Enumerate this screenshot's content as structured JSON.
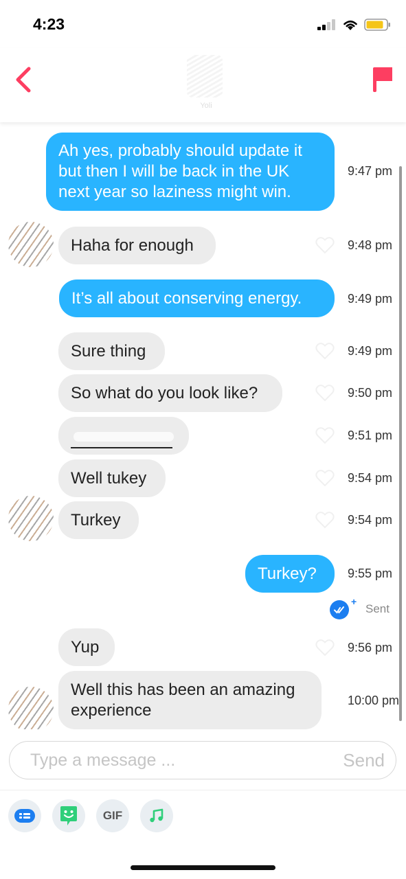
{
  "status_bar": {
    "time": "4:23"
  },
  "header": {
    "contact_name": "Yoli"
  },
  "messages": [
    {
      "side": "sent",
      "text": "Ah yes, probably should update it\nbut then I will be back in the UK\nnext year so laziness might win.",
      "time": "9:47 pm"
    },
    {
      "side": "received",
      "text": "Haha for enough",
      "time": "9:48 pm"
    },
    {
      "side": "sent",
      "text": "It’s all about conserving energy.",
      "time": "9:49 pm"
    },
    {
      "side": "received",
      "text": "Sure thing",
      "time": "9:49 pm"
    },
    {
      "side": "received",
      "text": "So what do you look like?",
      "time": "9:50 pm"
    },
    {
      "side": "received",
      "text": "",
      "time": "9:51 pm",
      "redacted": true
    },
    {
      "side": "received",
      "text": "Well tukey",
      "time": "9:54 pm"
    },
    {
      "side": "received",
      "text": "Turkey",
      "time": "9:54 pm"
    },
    {
      "side": "sent",
      "text": "Turkey?",
      "time": "9:55 pm"
    },
    {
      "side": "received",
      "text": "Yup",
      "time": "9:56 pm"
    },
    {
      "side": "received",
      "text": "Well this has been an amazing\nexperience",
      "time": "10:00 pm"
    }
  ],
  "read_receipt": {
    "label": "Sent"
  },
  "composer": {
    "placeholder": "Type a message ...",
    "send_label": "Send"
  },
  "toolbar": {
    "gif_label": "GIF"
  },
  "colors": {
    "accent": "#fd3e61",
    "sent_bubble": "#29b4ff",
    "received_bubble": "#ececec",
    "read_receipt": "#1c7ef0",
    "sticker": "#2fcf7a"
  }
}
